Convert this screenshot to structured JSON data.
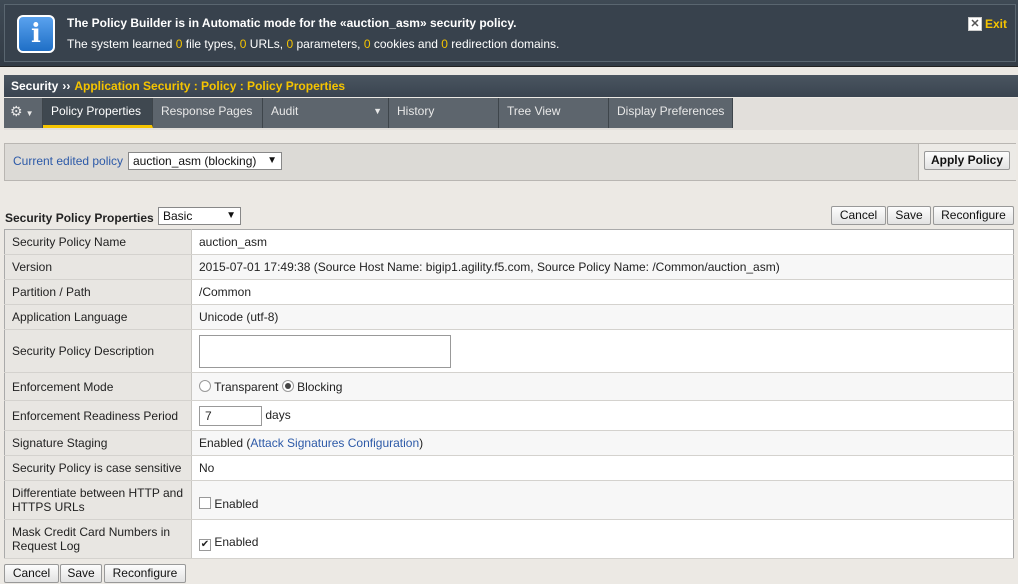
{
  "banner": {
    "title": "The Policy Builder is in Automatic mode for the «auction_asm» security policy.",
    "prefix": "The system learned ",
    "counts": [
      "0",
      "0",
      "0",
      "0",
      "0"
    ],
    "parts": [
      " file types, ",
      " URLs, ",
      " parameters, ",
      " cookies and ",
      " redirection domains."
    ],
    "exit_label": "Exit"
  },
  "breadcrumb": {
    "root": "Security",
    "separator": "››",
    "path": "Application Security : Policy : Policy Properties"
  },
  "tabs": [
    {
      "label": "Policy Properties"
    },
    {
      "label": "Response Pages"
    },
    {
      "label": "Audit"
    },
    {
      "label": "History"
    },
    {
      "label": "Tree View"
    },
    {
      "label": "Display Preferences"
    }
  ],
  "policybar": {
    "label": "Current edited policy",
    "selected": "auction_asm (blocking)",
    "apply_label": "Apply Policy"
  },
  "section": {
    "title": "Security Policy Properties",
    "view_mode": "Basic",
    "cancel": "Cancel",
    "save": "Save",
    "reconfigure": "Reconfigure"
  },
  "props": {
    "name_key": "Security Policy Name",
    "name_val": "auction_asm",
    "version_key": "Version",
    "version_val": "2015-07-01 17:49:38 (Source Host Name: bigip1.agility.f5.com, Source Policy Name: /Common/auction_asm)",
    "partition_key": "Partition / Path",
    "partition_val": "/Common",
    "lang_key": "Application Language",
    "lang_val": "Unicode (utf-8)",
    "desc_key": "Security Policy Description",
    "desc_val": "",
    "enforce_key": "Enforcement Mode",
    "enforce_opt1": "Transparent",
    "enforce_opt2": "Blocking",
    "enforce_selected": "Blocking",
    "readiness_key": "Enforcement Readiness Period",
    "readiness_val": "7",
    "readiness_unit": "days",
    "staging_key": "Signature Staging",
    "staging_val": "Enabled (",
    "staging_link": "Attack Signatures Configuration",
    "staging_close": ")",
    "case_key": "Security Policy is case sensitive",
    "case_val": "No",
    "diff_key": "Differentiate between HTTP and HTTPS URLs",
    "diff_label": "Enabled",
    "diff_checked": false,
    "mask_key": "Mask Credit Card Numbers in Request Log",
    "mask_label": "Enabled",
    "mask_checked": true
  },
  "bottom": {
    "cancel": "Cancel",
    "save": "Save",
    "reconfigure": "Reconfigure"
  }
}
